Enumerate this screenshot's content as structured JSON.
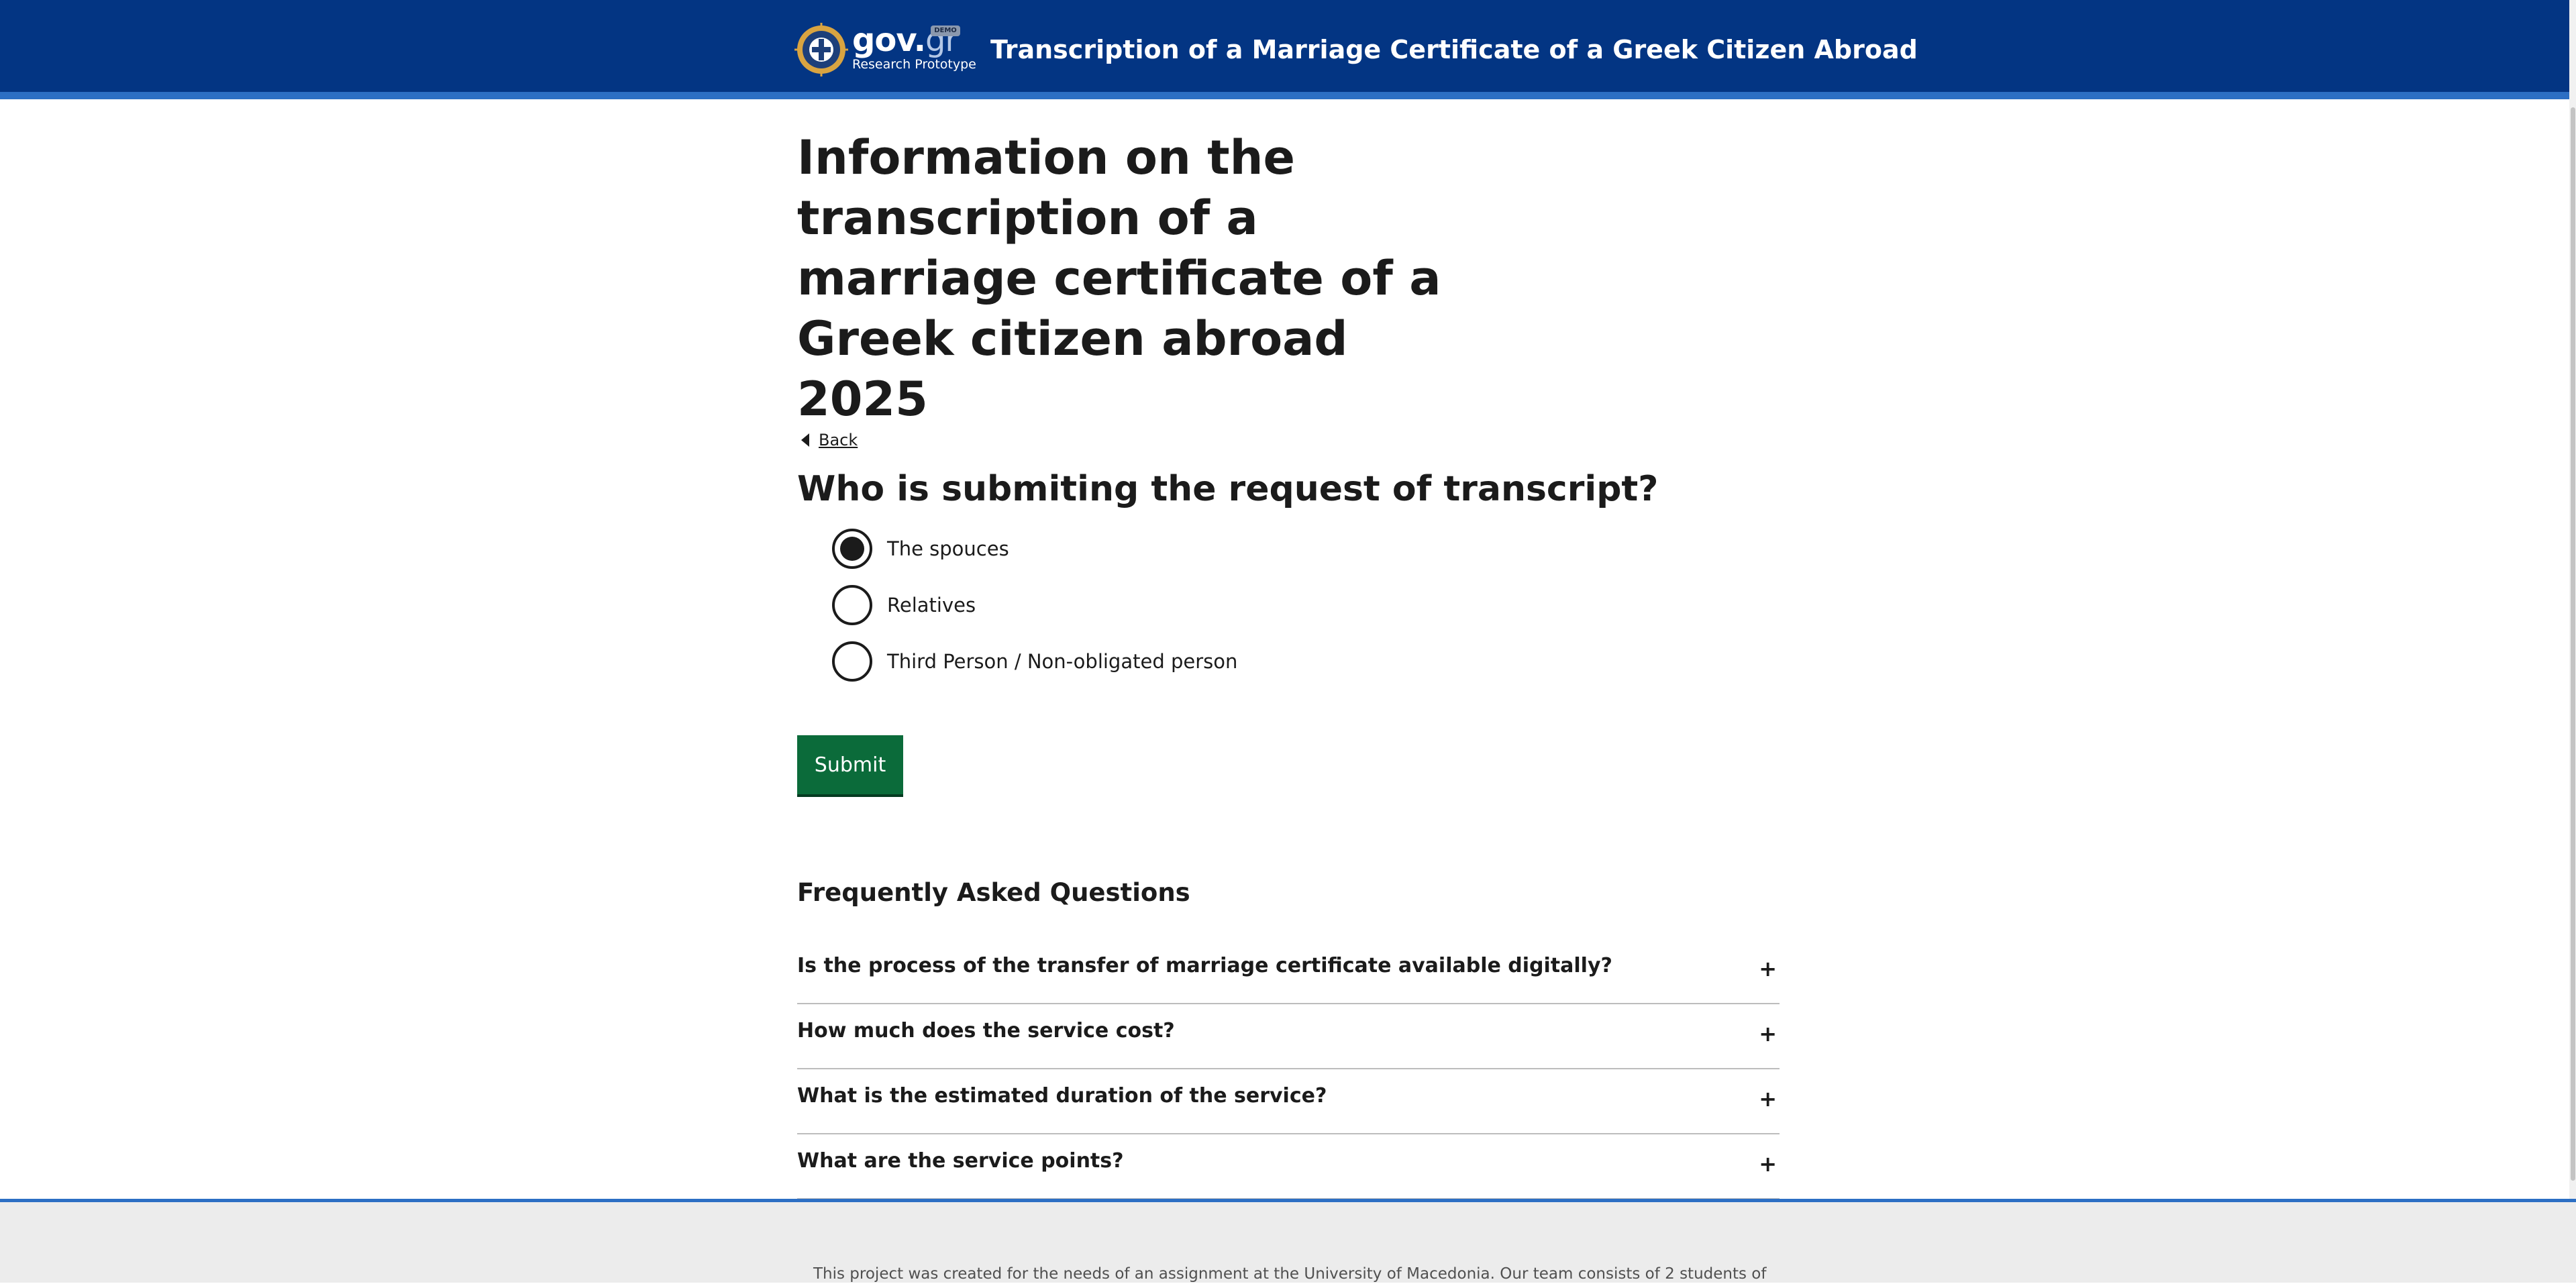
{
  "header": {
    "logo_main": "gov.",
    "logo_accent": "gr",
    "logo_badge": "DEMO",
    "logo_sub": "Research Prototype",
    "title": "Transcription of a Marriage Certificate of a Greek Citizen Abroad"
  },
  "main": {
    "page_title": "Information on the transcription of a marriage certificate of a Greek citizen abroad 2025",
    "back_label": "Back",
    "question": "Who is submiting the request of transcript?",
    "options": [
      {
        "label": "The spouces",
        "checked": true
      },
      {
        "label": "Relatives",
        "checked": false
      },
      {
        "label": "Third Person / Non-obligated person",
        "checked": false
      }
    ],
    "submit_label": "Submit"
  },
  "faq": {
    "heading": "Frequently Asked Questions",
    "items": [
      {
        "question": "Is the process of the transfer of marriage certificate available digitally?",
        "toggle": "+"
      },
      {
        "question": "How much does the service cost?",
        "toggle": "+"
      },
      {
        "question": "What is the estimated duration of the service?",
        "toggle": "+"
      },
      {
        "question": "What are the service points?",
        "toggle": "+"
      }
    ]
  },
  "footer": {
    "text": "This project was created for the needs of an assignment at the University of Macedonia. Our team consists of 2 students of"
  },
  "colors": {
    "header_bg": "#033583",
    "accent_blue": "#2c6fc4",
    "submit_green": "#0b6b3a",
    "footer_bg": "#ececec"
  },
  "icons": {
    "logo": "greek-emblem-icon",
    "back": "caret-left-icon",
    "faq_toggle": "plus-icon"
  }
}
